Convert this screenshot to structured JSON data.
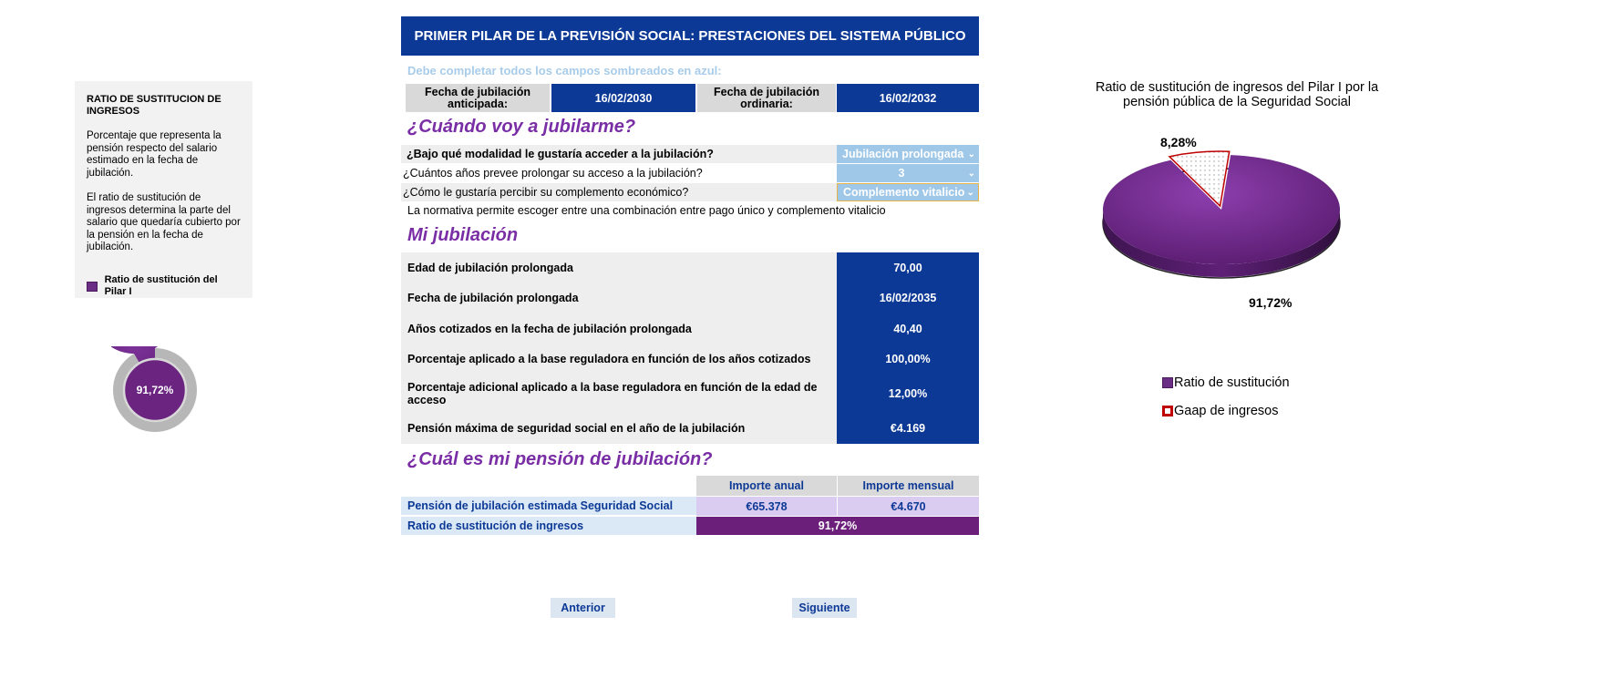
{
  "info_panel": {
    "title": "RATIO DE SUSTITUCION DE INGRESOS",
    "para1": "Porcentaje que representa la pensión respecto del salario estimado en la fecha de jubilación.",
    "para2": "El ratio de sustitución de ingresos determina la parte del salario que quedaría cubierto por la pensión en la fecha de jubilación.",
    "legend": "Ratio de sustitución del Pilar I"
  },
  "donut": {
    "label": "91,72%",
    "value": 0.9172
  },
  "header": {
    "title": "PRIMER PILAR DE LA PREVISIÓN SOCIAL: PRESTACIONES DEL SISTEMA PÚBLICO"
  },
  "instruction": "Debe completar todos los campos sombreados en azul:",
  "dates": {
    "anticipada_label": "Fecha de jubilación anticipada:",
    "anticipada_value": "16/02/2030",
    "ordinaria_label": "Fecha de jubilación ordinaria:",
    "ordinaria_value": "16/02/2032"
  },
  "section1": {
    "title": "¿Cuándo voy a jubilarme?",
    "questions": [
      {
        "label": "¿Bajo qué modalidad le gustaría acceder a la jubilación?",
        "value": "Jubilación prolongada"
      },
      {
        "label": "¿Cuántos años prevee prolongar su acceso a la jubilación?",
        "value": "3"
      },
      {
        "label": "¿Cómo le gustaría percibir su complemento económico?",
        "value": "Complemento vitalicio"
      }
    ],
    "note": "La normativa permite escoger entre una combinación entre pago único y complemento vitalicio"
  },
  "section2": {
    "title": "Mi jubilación",
    "rows": [
      {
        "label": "Edad de jubilación prolongada",
        "value": "70,00"
      },
      {
        "label": "Fecha de jubilación prolongada",
        "value": "16/02/2035"
      },
      {
        "label": "Años cotizados en la fecha de jubilación prolongada",
        "value": "40,40"
      },
      {
        "label": "Porcentaje aplicado a la base reguladora en función de los años cotizados",
        "value": "100,00%"
      },
      {
        "label": "Porcentaje adicional aplicado a la base reguladora en función de la edad de acceso",
        "value": "12,00%"
      },
      {
        "label": "Pensión máxima de seguridad social en el año de la jubilación",
        "value": "€4.169"
      }
    ]
  },
  "section3": {
    "title": "¿Cuál es mi pensión de jubilación?",
    "col_annual": "Importe anual",
    "col_monthly": "Importe mensual",
    "pension_label": "Pensión de jubilación estimada Seguridad Social",
    "pension_annual": "€65.378",
    "pension_monthly": "€4.670",
    "ratio_label": "Ratio de sustitución de ingresos",
    "ratio_value": "91,72%"
  },
  "nav": {
    "prev": "Anterior",
    "next": "Siguiente"
  },
  "colors": {
    "navy": "#0d3996",
    "purple": "#6b2e85",
    "light_blue": "#9fc7e8",
    "gap_red": "#c00000"
  },
  "chart_data": {
    "type": "pie",
    "title": "Ratio de sustitución de ingresos del Pilar I por la pensión pública de la Seguridad Social",
    "categories": [
      "Ratio de sustitución",
      "Gaap de ingresos"
    ],
    "values": [
      91.72,
      8.28
    ],
    "data_labels": [
      "91,72%",
      "8,28%"
    ],
    "colors": [
      "#6b2e85",
      "#ffffff"
    ],
    "legend_position": "bottom"
  }
}
